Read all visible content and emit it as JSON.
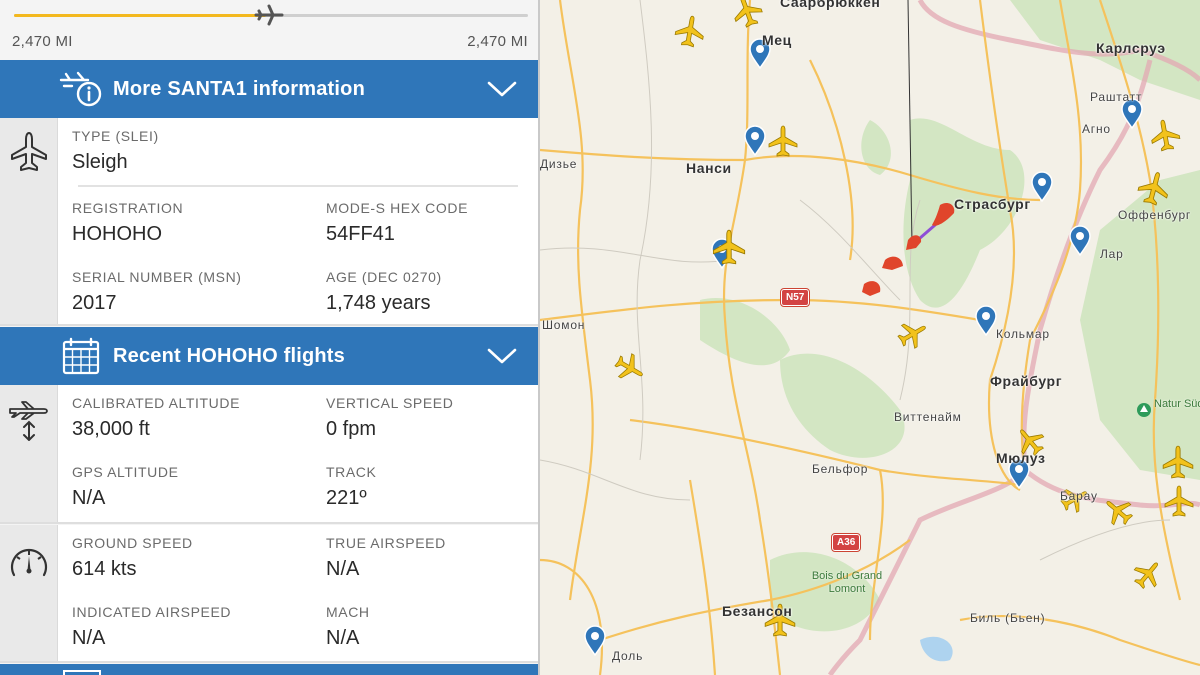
{
  "progress": {
    "fraction": 0.49,
    "left_label": "2,470 MI",
    "right_label": "2,470 MI"
  },
  "more_info": {
    "title": "More SANTA1 information",
    "icon": "plane-info-icon",
    "type_label": "TYPE (SLEI)",
    "type_value": "Sleigh",
    "registration_label": "REGISTRATION",
    "registration_value": "HOHOHO",
    "modes_label": "MODE-S HEX CODE",
    "modes_value": "54FF41",
    "serial_label": "SERIAL NUMBER (MSN)",
    "serial_value": "2017",
    "age_label": "AGE (DEC 0270)",
    "age_value": "1,748 years"
  },
  "recent_flights": {
    "title": "Recent HOHOHO flights",
    "icon": "calendar-icon"
  },
  "altitude": {
    "icon": "altitude-icon",
    "calibrated_label": "CALIBRATED ALTITUDE",
    "calibrated_value": "38,000 ft",
    "vspeed_label": "VERTICAL SPEED",
    "vspeed_value": "0 fpm",
    "gps_label": "GPS ALTITUDE",
    "gps_value": "N/A",
    "track_label": "TRACK",
    "track_value": "221º"
  },
  "speed": {
    "icon": "speedometer-icon",
    "ground_label": "GROUND SPEED",
    "ground_value": "614 kts",
    "tas_label": "TRUE AIRSPEED",
    "tas_value": "N/A",
    "ias_label": "INDICATED AIRSPEED",
    "ias_value": "N/A",
    "mach_label": "MACH",
    "mach_value": "N/A"
  },
  "map": {
    "cities": [
      "Саарбрюккен",
      "Карлсруэ",
      "Мец",
      "Нанси",
      "Страсбург",
      "Фрайбург",
      "Мюлуз",
      "Безансон"
    ],
    "towns": [
      "Раштатт",
      "Агно",
      "Оффенбург",
      "Лар",
      "Дизье",
      "Кольмар",
      "Шомон",
      "Виттенайм",
      "Бельфор",
      "Доль",
      "Биль (Бьен)",
      "Барау"
    ],
    "roads": [
      "N57",
      "A36"
    ],
    "parks": [
      "Bois du Grand Lomont",
      "Natur Südsc"
    ]
  },
  "colors": {
    "accent": "#2f76b9",
    "progress": "#f3b81e",
    "plane": "#f2c21b",
    "sleigh": "#e0452b",
    "forest": "#cfe3bf",
    "road": "#f5c25c"
  }
}
